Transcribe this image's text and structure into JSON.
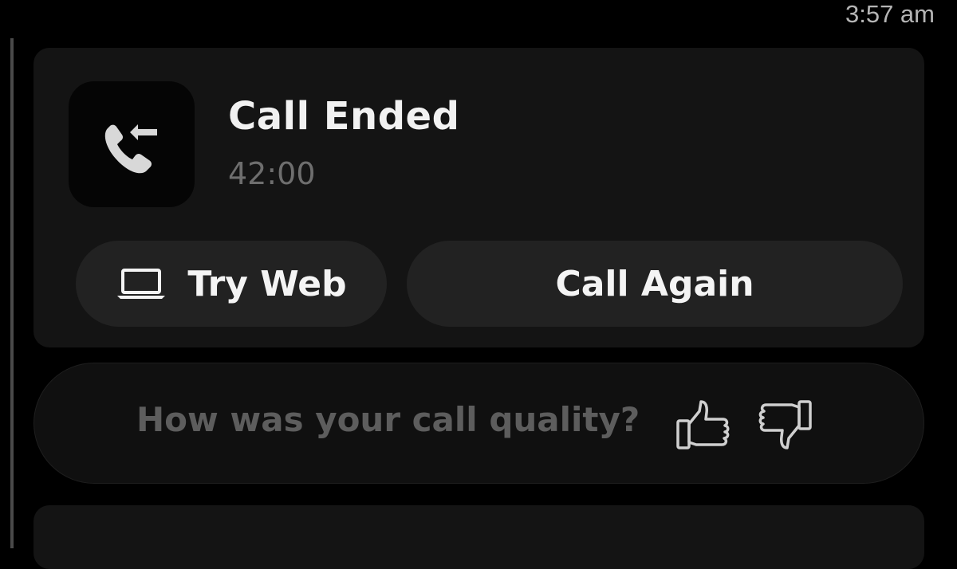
{
  "header": {
    "timestamp": "3:57 am"
  },
  "call": {
    "icon": "incoming-call-icon",
    "title": "Call Ended",
    "duration": "42:00",
    "try_web_label": "Try Web",
    "try_web_icon": "laptop-icon",
    "call_again_label": "Call Again"
  },
  "feedback": {
    "prompt": "How was your call quality?",
    "thumbs_up_icon": "thumbs-up-icon",
    "thumbs_down_icon": "thumbs-down-icon"
  },
  "colors": {
    "background": "#000000",
    "card": "#141414",
    "button": "#222222",
    "muted_text": "#5d5d5d"
  }
}
